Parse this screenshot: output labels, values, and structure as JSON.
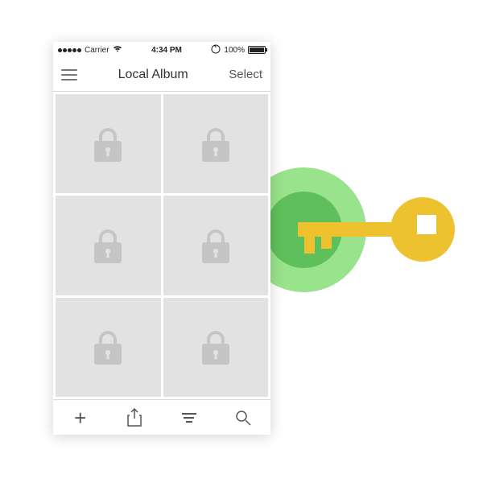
{
  "status": {
    "carrier": "Carrier",
    "time": "4:34 PM",
    "battery_text": "100%"
  },
  "navbar": {
    "title": "Local Album",
    "select_label": "Select"
  },
  "grid": {
    "cell_count": 6,
    "locked": true
  },
  "tabbar": {
    "add": "+",
    "share": "share",
    "sort": "sort",
    "search": "search"
  },
  "decor": {
    "key_color": "#eec22e",
    "circle_outer": "#99e38c",
    "circle_inner": "#5fbf5b"
  }
}
